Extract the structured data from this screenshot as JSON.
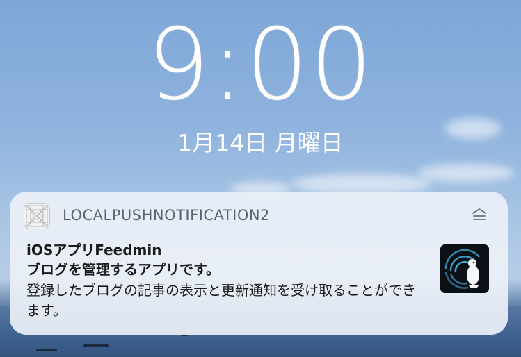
{
  "lockscreen": {
    "time": "9:00",
    "date": "1月14日 月曜日"
  },
  "notification": {
    "app_name": "LOCALPUSHNOTIFICATION2",
    "title": "iOSアプリFeedmin",
    "subtitle": "ブログを管理するアプリです。",
    "body": "登録したブログの記事の表示と更新通知を受け取ることができます。",
    "app_icon": "grid-placeholder-icon",
    "group_icon": "notification-group-icon",
    "thumbnail_icon": "penguin-thumbnail-icon"
  },
  "colors": {
    "sky": "#8fb3de",
    "notification_bg": "#eceff7",
    "text_primary": "#1a1a1a",
    "text_secondary": "#5a6270"
  }
}
